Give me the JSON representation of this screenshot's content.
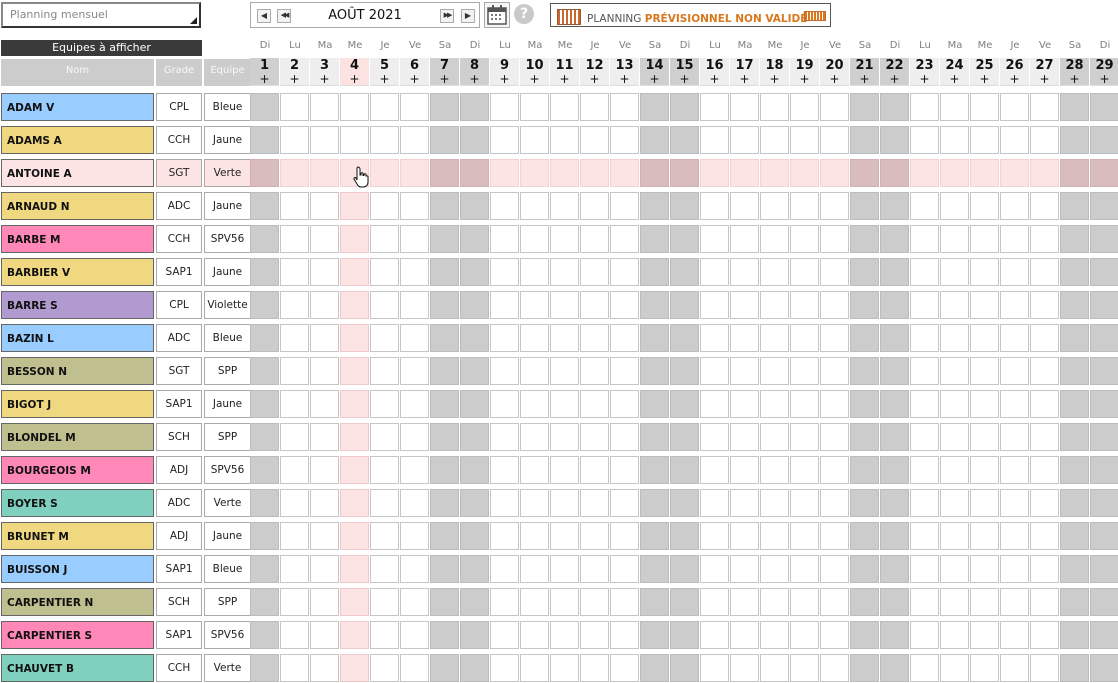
{
  "view_select": {
    "value": "Planning mensuel"
  },
  "nav": {
    "prev_month": "◀",
    "prev_year": "◀◀",
    "next_year": "▶▶",
    "next_month": "▶",
    "month_label": "AOÛT 2021"
  },
  "status": {
    "prefix": "PLANNING",
    "label": "PRÉVISIONNEL NON VALIDÉ"
  },
  "help": "?",
  "left_header": {
    "teams": "Equipes à afficher",
    "name": "Nom",
    "grade": "Grade",
    "team": "Equipe"
  },
  "add_symbol": "+",
  "days": [
    {
      "n": "1",
      "d": "Di"
    },
    {
      "n": "2",
      "d": "Lu"
    },
    {
      "n": "3",
      "d": "Ma"
    },
    {
      "n": "4",
      "d": "Me"
    },
    {
      "n": "5",
      "d": "Je"
    },
    {
      "n": "6",
      "d": "Ve"
    },
    {
      "n": "7",
      "d": "Sa"
    },
    {
      "n": "8",
      "d": "Di"
    },
    {
      "n": "9",
      "d": "Lu"
    },
    {
      "n": "10",
      "d": "Ma"
    },
    {
      "n": "11",
      "d": "Me"
    },
    {
      "n": "12",
      "d": "Je"
    },
    {
      "n": "13",
      "d": "Ve"
    },
    {
      "n": "14",
      "d": "Sa"
    },
    {
      "n": "15",
      "d": "Di"
    },
    {
      "n": "16",
      "d": "Lu"
    },
    {
      "n": "17",
      "d": "Ma"
    },
    {
      "n": "18",
      "d": "Me"
    },
    {
      "n": "19",
      "d": "Je"
    },
    {
      "n": "20",
      "d": "Ve"
    },
    {
      "n": "21",
      "d": "Sa"
    },
    {
      "n": "22",
      "d": "Di"
    },
    {
      "n": "23",
      "d": "Lu"
    },
    {
      "n": "24",
      "d": "Ma"
    },
    {
      "n": "25",
      "d": "Me"
    },
    {
      "n": "26",
      "d": "Je"
    },
    {
      "n": "27",
      "d": "Ve"
    },
    {
      "n": "28",
      "d": "Sa"
    },
    {
      "n": "29",
      "d": "Di"
    }
  ],
  "today_day": "4",
  "highlighted_row": "ANTOINE A",
  "team_colors": {
    "Bleue": "#99ccff",
    "Jaune": "#f0d880",
    "Verte": "#80d0c0",
    "SPV56": "#ff88b8",
    "Violette": "#b09ad0",
    "SPP": "#bfbf90",
    "Highlight": "#fde4e4"
  },
  "personnel": [
    {
      "name": "ADAM V",
      "grade": "CPL",
      "team": "Bleue"
    },
    {
      "name": "ADAMS A",
      "grade": "CCH",
      "team": "Jaune"
    },
    {
      "name": "ANTOINE A",
      "grade": "SGT",
      "team": "Verte"
    },
    {
      "name": "ARNAUD N",
      "grade": "ADC",
      "team": "Jaune"
    },
    {
      "name": "BARBE M",
      "grade": "CCH",
      "team": "SPV56"
    },
    {
      "name": "BARBIER V",
      "grade": "SAP1",
      "team": "Jaune"
    },
    {
      "name": "BARRE S",
      "grade": "CPL",
      "team": "Violette"
    },
    {
      "name": "BAZIN L",
      "grade": "ADC",
      "team": "Bleue"
    },
    {
      "name": "BESSON N",
      "grade": "SGT",
      "team": "SPP"
    },
    {
      "name": "BIGOT J",
      "grade": "SAP1",
      "team": "Jaune"
    },
    {
      "name": "BLONDEL M",
      "grade": "SCH",
      "team": "SPP"
    },
    {
      "name": "BOURGEOIS M",
      "grade": "ADJ",
      "team": "SPV56"
    },
    {
      "name": "BOYER S",
      "grade": "ADC",
      "team": "Verte"
    },
    {
      "name": "BRUNET M",
      "grade": "ADJ",
      "team": "Jaune"
    },
    {
      "name": "BUISSON J",
      "grade": "SAP1",
      "team": "Bleue"
    },
    {
      "name": "CARPENTIER N",
      "grade": "SCH",
      "team": "SPP"
    },
    {
      "name": "CARPENTIER S",
      "grade": "SAP1",
      "team": "SPV56"
    },
    {
      "name": "CHAUVET B",
      "grade": "CCH",
      "team": "Verte"
    }
  ]
}
